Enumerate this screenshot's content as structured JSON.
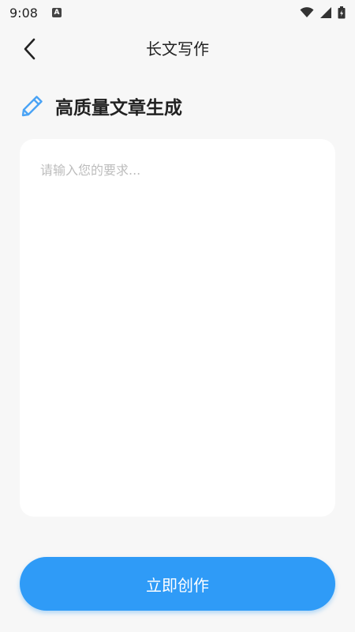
{
  "status_bar": {
    "time": "9:08",
    "notification_letter": "A",
    "icons": [
      "wifi-icon",
      "signal-icon",
      "battery-icon"
    ]
  },
  "header": {
    "title": "长文写作",
    "back_icon": "chevron-left-icon"
  },
  "section": {
    "icon": "pencil-icon",
    "title": "高质量文章生成"
  },
  "editor": {
    "value": "",
    "placeholder": "请输入您的要求..."
  },
  "actions": {
    "create_label": "立即创作"
  },
  "colors": {
    "accent": "#2f9bf7",
    "icon_blue": "#4aa3f5",
    "background": "#f7f7f7",
    "card": "#ffffff",
    "placeholder": "#bdbdbd"
  }
}
